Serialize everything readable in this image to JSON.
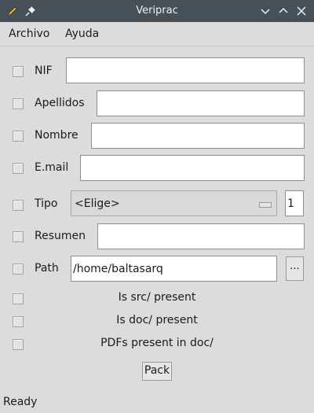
{
  "window": {
    "title": "Veriprac"
  },
  "menubar": {
    "items": [
      "Archivo",
      "Ayuda"
    ]
  },
  "form": {
    "nif_label": "NIF",
    "apellidos_label": "Apellidos",
    "nombre_label": "Nombre",
    "email_label": "E.mail",
    "tipo_label": "Tipo",
    "tipo_value": "<Elige>",
    "tipo_number": "1",
    "resumen_label": "Resumen",
    "path_label": "Path",
    "path_value": "/home/baltasarq",
    "browse_label": "..."
  },
  "checks": {
    "src": "Is src/ present",
    "doc": "Is doc/ present",
    "pdfs": "PDFs present in doc/"
  },
  "pack_label": "Pack",
  "status": "Ready",
  "colors": {
    "titlebar": "#475057",
    "background": "#dcdcdc"
  },
  "icons": [
    "pencil-icon",
    "pin-icon",
    "minimize-icon",
    "maximize-icon",
    "close-icon",
    "combo-indicator-icon"
  ]
}
